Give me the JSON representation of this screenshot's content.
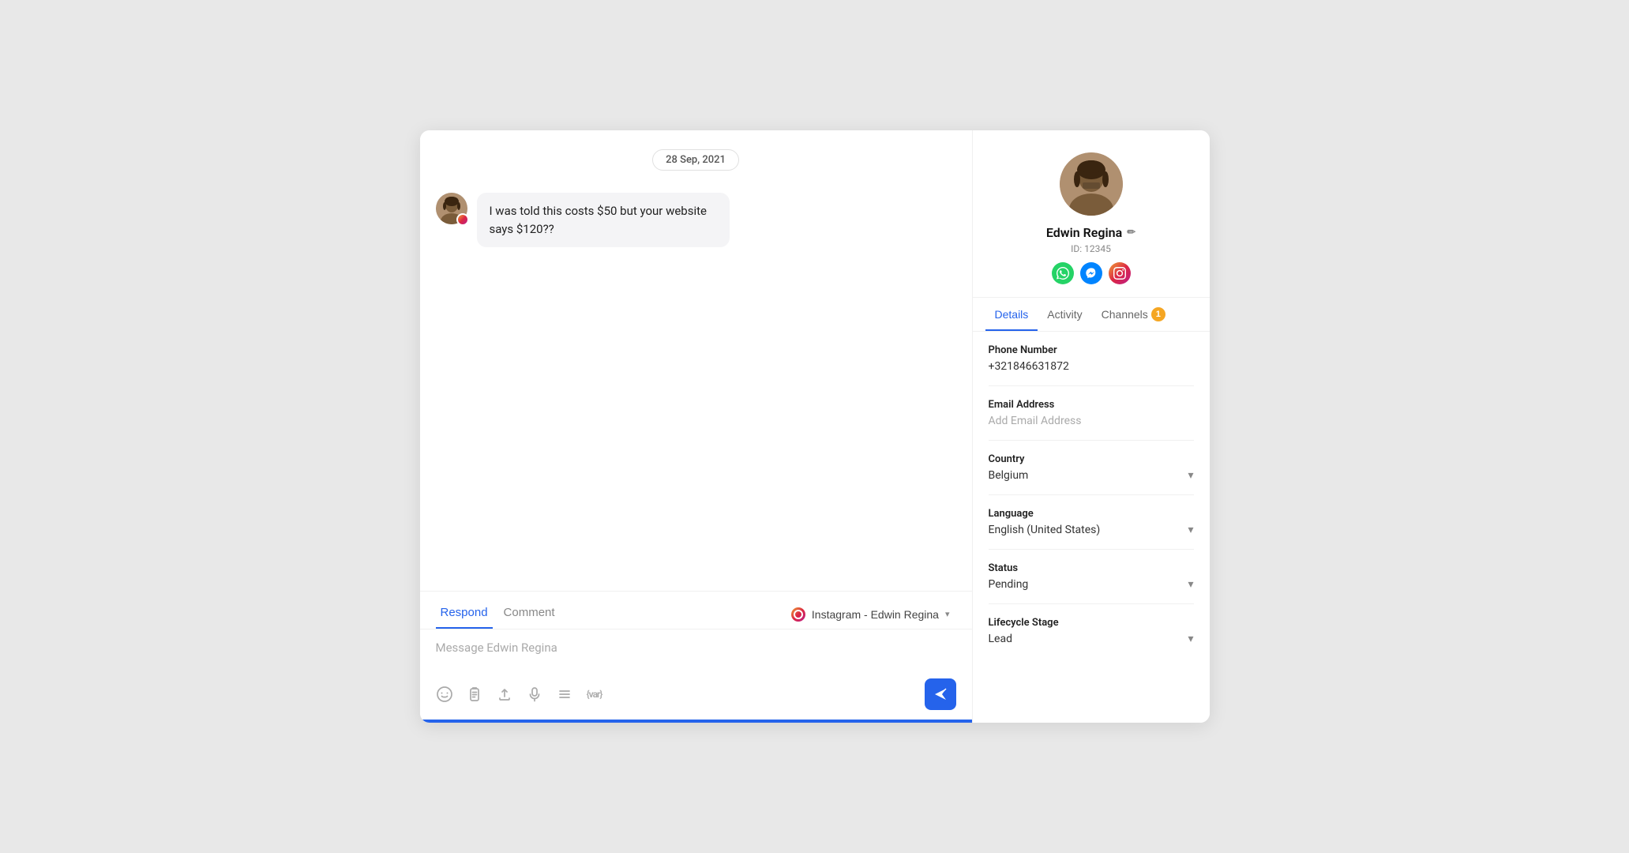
{
  "chat": {
    "date_badge": "28 Sep, 2021",
    "message_text": "I was told this costs $50 but your website says $120??",
    "compose_tabs": [
      {
        "label": "Respond",
        "active": true
      },
      {
        "label": "Comment",
        "active": false
      }
    ],
    "channel_selector_label": "Instagram - Edwin Regina",
    "compose_placeholder": "Message Edwin Regina",
    "toolbar_icons": [
      {
        "name": "emoji-icon",
        "symbol": "☺"
      },
      {
        "name": "clipboard-icon",
        "symbol": "📋"
      },
      {
        "name": "upload-icon",
        "symbol": "⬆"
      },
      {
        "name": "mic-icon",
        "symbol": "🎤"
      },
      {
        "name": "list-icon",
        "symbol": "☰"
      },
      {
        "name": "variable-icon",
        "symbol": "{var}"
      }
    ],
    "send_label": "Send"
  },
  "contact": {
    "name": "Edwin Regina",
    "id_label": "ID: 12345",
    "tabs": [
      {
        "label": "Details",
        "active": true
      },
      {
        "label": "Activity",
        "active": false
      },
      {
        "label": "Channels",
        "active": false,
        "badge": "1"
      }
    ],
    "details": {
      "phone_number_label": "Phone Number",
      "phone_number_value": "+321846631872",
      "email_label": "Email Address",
      "email_placeholder": "Add Email Address",
      "country_label": "Country",
      "country_value": "Belgium",
      "language_label": "Language",
      "language_value": "English (United States)",
      "status_label": "Status",
      "status_value": "Pending",
      "lifecycle_label": "Lifecycle Stage",
      "lifecycle_value": "Lead"
    }
  }
}
